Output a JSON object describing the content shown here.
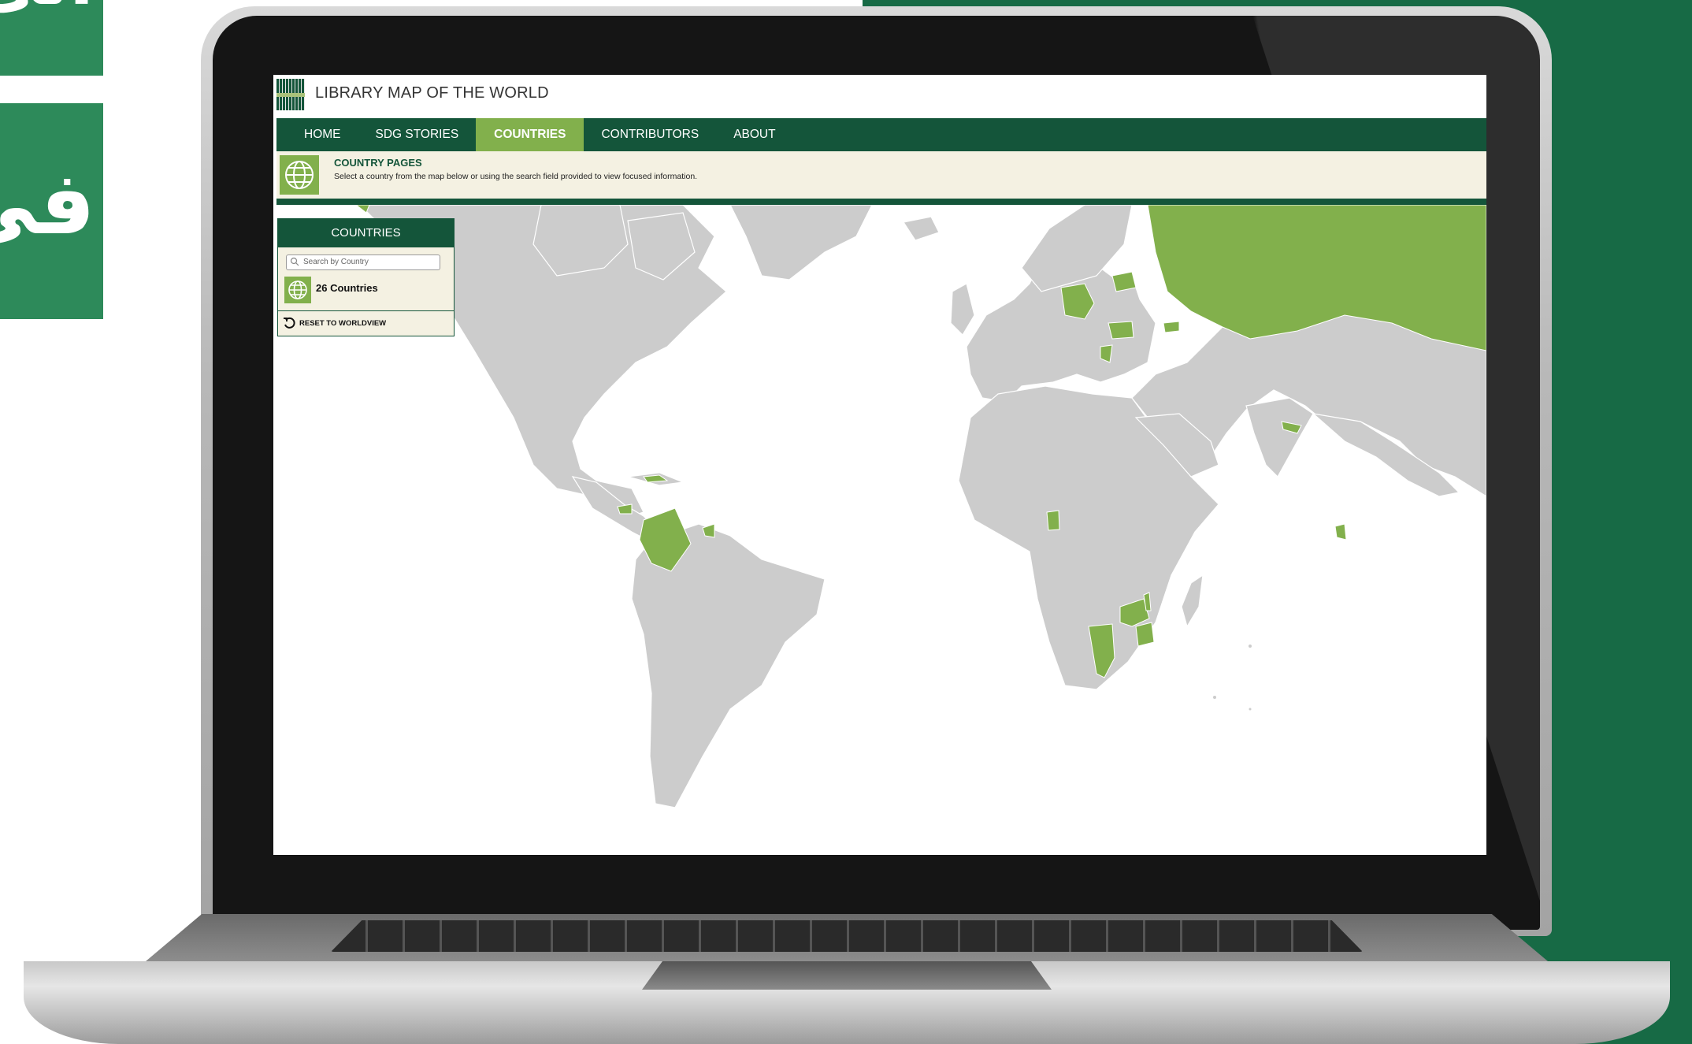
{
  "decoration": {
    "tiles": [
      "الى",
      "في"
    ]
  },
  "site": {
    "title": "LIBRARY MAP OF THE WORLD"
  },
  "nav": {
    "items": [
      {
        "label": "HOME"
      },
      {
        "label": "SDG STORIES"
      },
      {
        "label": "COUNTRIES"
      },
      {
        "label": "CONTRIBUTORS"
      },
      {
        "label": "ABOUT"
      }
    ],
    "active": "COUNTRIES"
  },
  "banner": {
    "title": "COUNTRY PAGES",
    "subtitle": "Select a country from the map below or using the search field provided to view focused information."
  },
  "panel": {
    "title": "COUNTRIES",
    "search": {
      "placeholder": "Search by Country",
      "value": ""
    },
    "count": "26 Countries",
    "reset_label": "RESET TO WORLDVIEW"
  },
  "colors": {
    "brand_dark_green": "#14553a",
    "accent_green": "#82b04c",
    "banner_bg": "#f4f1e2",
    "land_grey": "#cccccc",
    "background_green": "#176a45"
  },
  "map": {
    "highlighted_countries": [
      "Russia",
      "Germany",
      "Belarus",
      "Romania",
      "Bulgaria",
      "Albania",
      "Greece",
      "Colombia",
      "Guyana",
      "Honduras",
      "Cuba",
      "Jamaica",
      "Ghana",
      "Namibia",
      "Zambia",
      "Zimbabwe",
      "Malawi",
      "Nepal",
      "Malaysia",
      "Latvia",
      "Moldova",
      "Georgia"
    ]
  }
}
